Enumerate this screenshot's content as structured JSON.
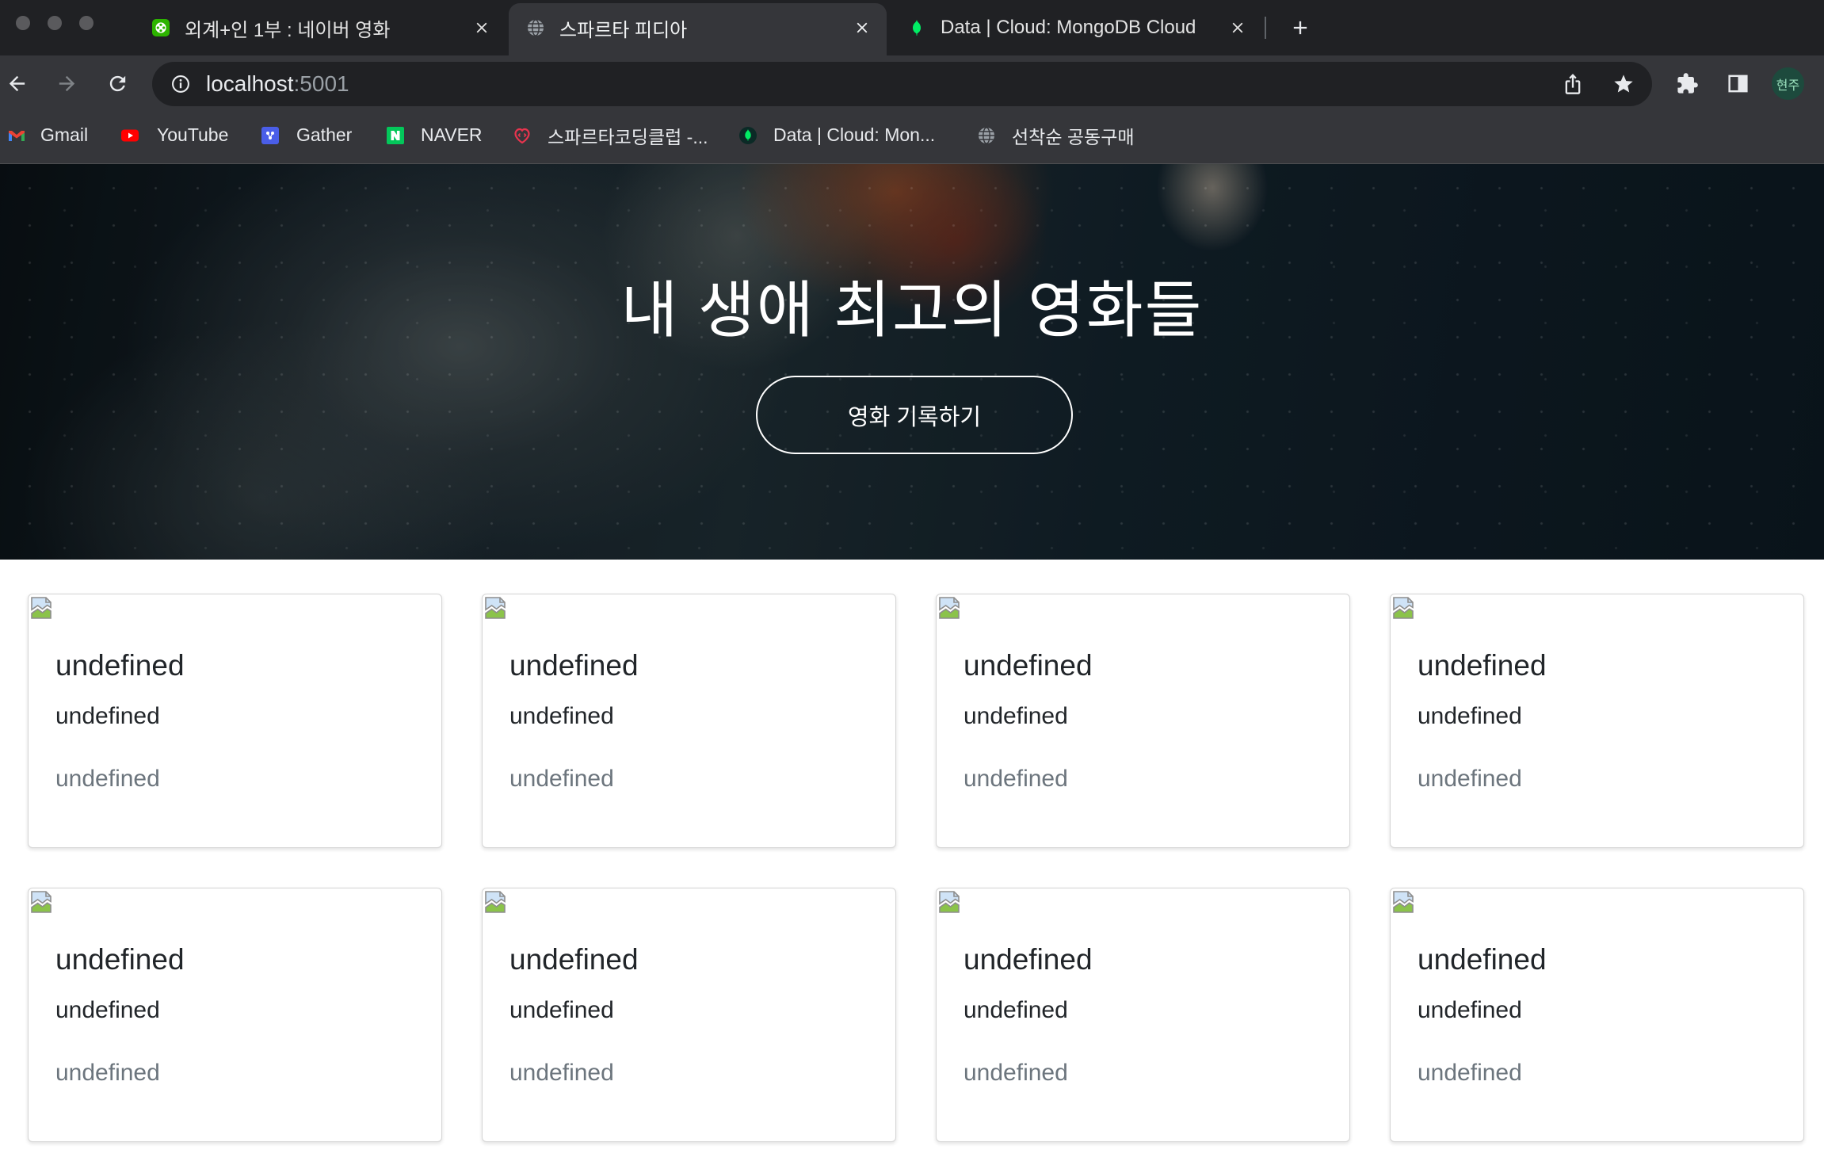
{
  "browser": {
    "tabs": [
      {
        "title": "외계+인 1부 : 네이버 영화",
        "icon": "naver-movie-icon",
        "active": false
      },
      {
        "title": "스파르타 피디아",
        "icon": "globe-icon",
        "active": true
      },
      {
        "title": "Data | Cloud: MongoDB Cloud",
        "icon": "mongodb-leaf-icon",
        "active": false
      }
    ],
    "address_bar": {
      "host": "localhost",
      "port": ":5001"
    },
    "profile": {
      "label": "현주"
    },
    "bookmarks": [
      {
        "label": "Gmail",
        "icon": "gmail-icon"
      },
      {
        "label": "YouTube",
        "icon": "youtube-icon"
      },
      {
        "label": "Gather",
        "icon": "gather-icon"
      },
      {
        "label": "NAVER",
        "icon": "naver-icon"
      },
      {
        "label": "스파르타코딩클럽 -...",
        "icon": "sparta-coding-club-icon"
      },
      {
        "label": "Data | Cloud: Mon...",
        "icon": "mongodb-leaf-icon"
      },
      {
        "label": "선착순 공동구매",
        "icon": "globe-icon"
      }
    ]
  },
  "page": {
    "hero": {
      "title": "내 생애 최고의 영화들",
      "button_label": "영화 기록하기"
    },
    "cards": [
      {
        "image": "broken-image-icon",
        "title": "undefined",
        "comment": "undefined",
        "meta": "undefined"
      },
      {
        "image": "broken-image-icon",
        "title": "undefined",
        "comment": "undefined",
        "meta": "undefined"
      },
      {
        "image": "broken-image-icon",
        "title": "undefined",
        "comment": "undefined",
        "meta": "undefined"
      },
      {
        "image": "broken-image-icon",
        "title": "undefined",
        "comment": "undefined",
        "meta": "undefined"
      },
      {
        "image": "broken-image-icon",
        "title": "undefined",
        "comment": "undefined",
        "meta": "undefined"
      },
      {
        "image": "broken-image-icon",
        "title": "undefined",
        "comment": "undefined",
        "meta": "undefined"
      },
      {
        "image": "broken-image-icon",
        "title": "undefined",
        "comment": "undefined",
        "meta": "undefined"
      },
      {
        "image": "broken-image-icon",
        "title": "undefined",
        "comment": "undefined",
        "meta": "undefined"
      }
    ]
  },
  "colors": {
    "tab_strip": "#202124",
    "toolbar": "#35363a",
    "omnibox": "#202124",
    "hero_text": "#ffffff",
    "card_text": "#212529",
    "card_meta_text": "#6c757d"
  }
}
